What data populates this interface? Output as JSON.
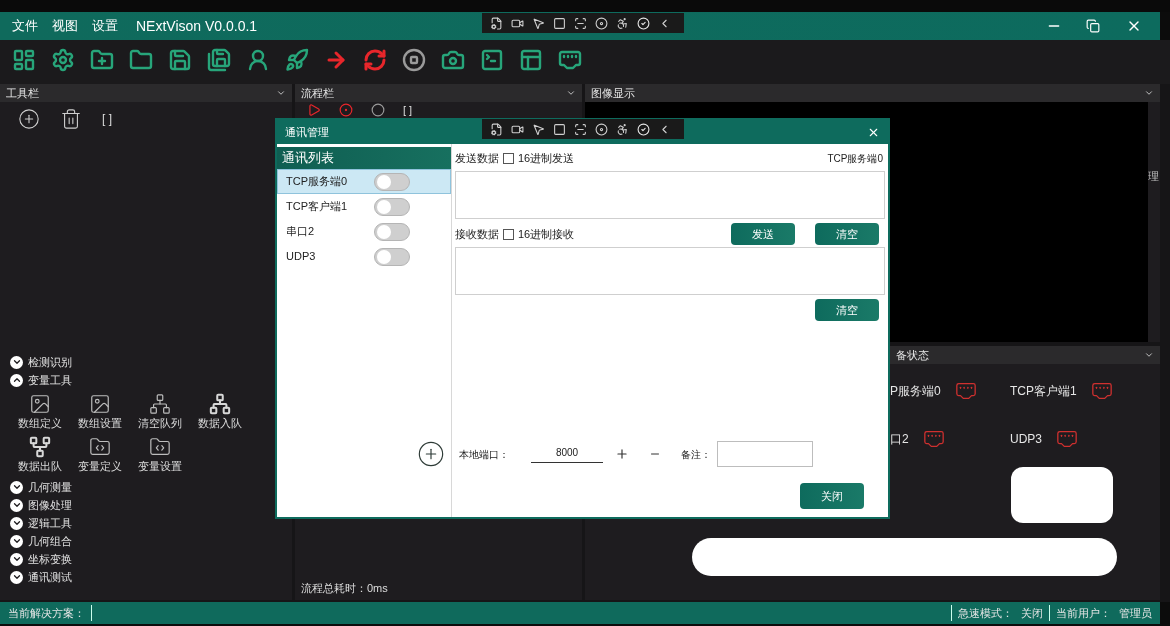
{
  "menu_bar": {
    "items": [
      "文件",
      "视图",
      "设置"
    ],
    "app_title": "NExtVison V0.0.0.1"
  },
  "toolbar": [
    {
      "color": "#27a57a"
    },
    {
      "color": "#27a57a"
    },
    {
      "color": "#27a57a"
    },
    {
      "color": "#27a57a"
    },
    {
      "color": "#27a57a"
    },
    {
      "color": "#27a57a"
    },
    {
      "color": "#27a57a"
    },
    {
      "color": "#27a57a"
    },
    {
      "color": "#e8262b"
    },
    {
      "color": "#e8262b"
    },
    {
      "color": "#9a9a9a"
    },
    {
      "color": "#27a57a"
    },
    {
      "color": "#27a57a"
    },
    {
      "color": "#27a57a"
    },
    {
      "color": "#27a57a"
    }
  ],
  "toolbox_panel": {
    "title": "工具栏",
    "bracket": "[ ]",
    "categories": [
      {
        "label": "检测识别",
        "expanded": false
      },
      {
        "label": "变量工具",
        "expanded": true,
        "tools": [
          {
            "label": "数组定义",
            "kind": "image"
          },
          {
            "label": "数组设置",
            "kind": "image"
          },
          {
            "label": "清空队列",
            "kind": "tree"
          },
          {
            "label": "数据入队",
            "kind": "tree-filled"
          },
          {
            "label": "数据出队",
            "kind": "tree-up"
          },
          {
            "label": "变量定义",
            "kind": "code-folder"
          },
          {
            "label": "变量设置",
            "kind": "code-folder"
          }
        ]
      },
      {
        "label": "几何测量",
        "expanded": false
      },
      {
        "label": "图像处理",
        "expanded": false
      },
      {
        "label": "逻辑工具",
        "expanded": false
      },
      {
        "label": "几何组合",
        "expanded": false
      },
      {
        "label": "坐标变换",
        "expanded": false
      },
      {
        "label": "通讯测试",
        "expanded": false
      }
    ]
  },
  "flow_panel": {
    "title": "流程栏",
    "bracket": "[ ]",
    "total_time": "流程总耗时：0ms"
  },
  "image_panel": {
    "title": "图像显示",
    "side_label": "理"
  },
  "device_status_panel": {
    "title": "备状态",
    "devices": [
      {
        "name": "P服务端0"
      },
      {
        "name": "TCP客户端1"
      },
      {
        "name": "口2"
      },
      {
        "name": "UDP3"
      }
    ]
  },
  "status_bar": {
    "solution_label": "当前解决方案：",
    "speed_mode_label": "急速模式：",
    "speed_mode": "关闭",
    "user_label": "当前用户：",
    "user": "管理员"
  },
  "dialog": {
    "title": "通讯管理",
    "connections": {
      "title": "通讯列表",
      "items": [
        {
          "name": "TCP服务端0",
          "selected": true,
          "on": false
        },
        {
          "name": "TCP客户端1",
          "selected": false,
          "on": false
        },
        {
          "name": "串口2",
          "selected": false,
          "on": false
        },
        {
          "name": "UDP3",
          "selected": false,
          "on": false
        }
      ]
    },
    "send": {
      "label": "发送数据",
      "hex_option": {
        "label": "16进制发送",
        "checked": false
      },
      "current_connection": "TCP服务端0"
    },
    "receive": {
      "label": "接收数据",
      "hex_option": {
        "label": "16进制接收",
        "checked": false
      }
    },
    "send_button": "发送",
    "clear_send_button": "清空",
    "clear_receive_button": "清空",
    "local_port": {
      "label": "本地端口：",
      "value": "8000"
    },
    "note": {
      "label": "备注："
    },
    "close_button": "关闭"
  }
}
